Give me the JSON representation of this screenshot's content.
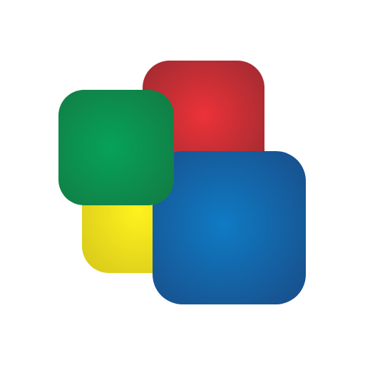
{
  "logo": {
    "icon": "overlapping-rounded-squares-logo",
    "colors": {
      "red": "#d3323a",
      "yellow": "#f2e51f",
      "blue": "#1466ad",
      "green": "#0b9650",
      "background": "#ffffff"
    }
  }
}
